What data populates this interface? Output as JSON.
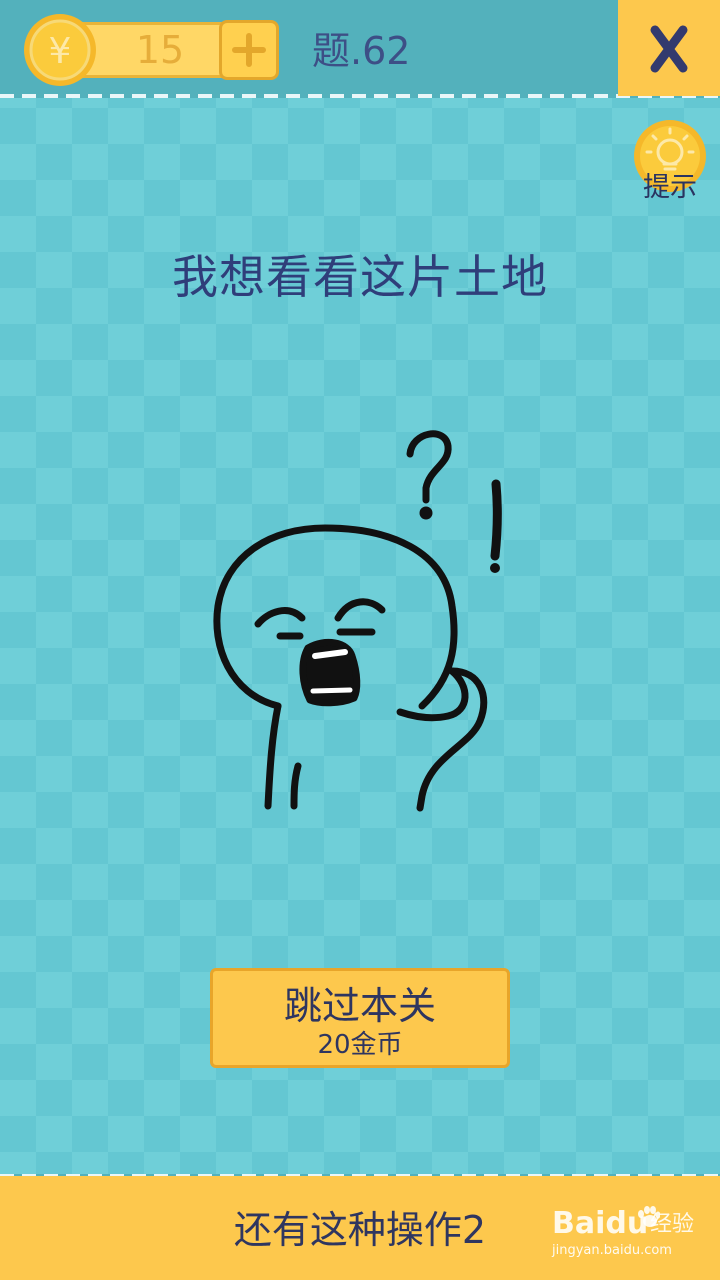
{
  "header": {
    "coin_symbol": "¥",
    "coin_count": "15",
    "level_label": "题.62",
    "close_label": "X"
  },
  "hint": {
    "label": "提示"
  },
  "question": {
    "text": "我想看看这片土地"
  },
  "figure": {
    "icon": "confused-stick-figure",
    "marks": [
      "?",
      "!"
    ]
  },
  "skip": {
    "title": "跳过本关",
    "cost": "20金币"
  },
  "footer": {
    "text": "还有这种操作2"
  },
  "watermark": {
    "brand": "Baidu",
    "suffix": "经验",
    "url": "jingyan.baidu.com"
  },
  "colors": {
    "background": "#6fcfd8",
    "topbar": "#53b1bc",
    "accent_yellow": "#fdc84d",
    "text_dark_blue": "#2f3e7a"
  }
}
